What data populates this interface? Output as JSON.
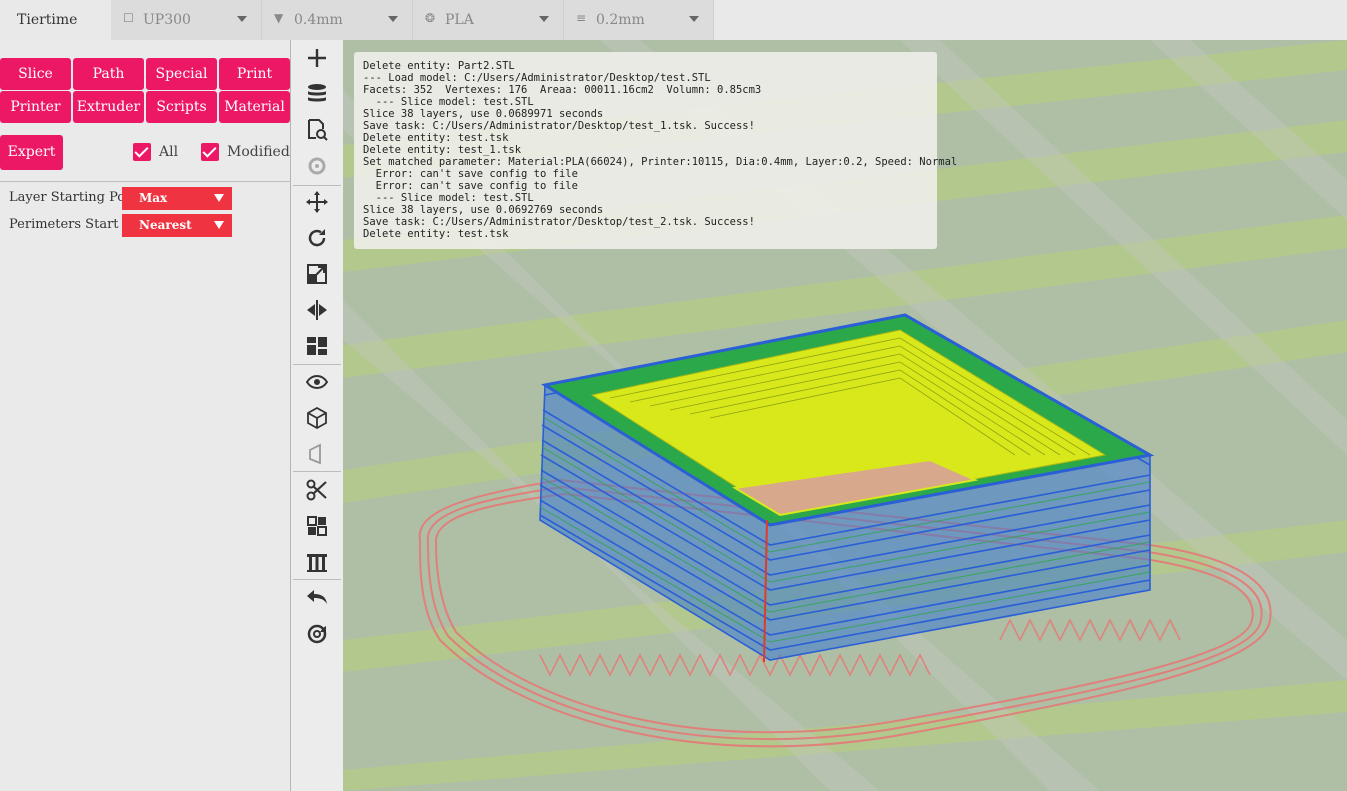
{
  "app": {
    "title": "Tiertime"
  },
  "top_combos": [
    {
      "icon": "printer-icon",
      "glyph": "☐",
      "value": "UP300"
    },
    {
      "icon": "nozzle-icon",
      "glyph": "▼",
      "value": "0.4mm"
    },
    {
      "icon": "material-icon",
      "glyph": "❂",
      "value": "PLA"
    },
    {
      "icon": "layer-icon",
      "glyph": "≡",
      "value": "0.2mm"
    }
  ],
  "tabs_row1": [
    "Slice",
    "Path",
    "Special",
    "Print"
  ],
  "tabs_row2": [
    "Printer",
    "Extruder",
    "Scripts",
    "Material"
  ],
  "expert_label": "Expert",
  "filters": {
    "all_label": "All",
    "all_checked": true,
    "modified_label": "Modified",
    "modified_checked": true
  },
  "params": [
    {
      "label": "Layer Starting Point",
      "value": "Max"
    },
    {
      "label": "Perimeters Start",
      "value": "Nearest"
    }
  ],
  "toolbar": [
    "add-icon",
    "database-icon",
    "search-file-icon",
    "camera-icon",
    "move-icon",
    "rotate-icon",
    "scale-icon",
    "mirror-icon",
    "layout-icon",
    "eye-icon",
    "cube-icon",
    "view-icon",
    "cut-icon",
    "grid-icon",
    "support-icon",
    "undo-icon",
    "settings-cycle-icon"
  ],
  "log": [
    "Delete entity: Part2.STL",
    "--- Load model: C:/Users/Administrator/Desktop/test.STL",
    "Facets: 352  Vertexes: 176  Areaa: 00011.16cm2  Volumn: 0.85cm3",
    "  --- Slice model: test.STL",
    "Slice 38 layers, use 0.0689971 seconds",
    "Save task: C:/Users/Administrator/Desktop/test_1.tsk. Success!",
    "Delete entity: test.tsk",
    "Delete entity: test_1.tsk",
    "Set matched parameter: Material:PLA(66024), Printer:10115, Dia:0.4mm, Layer:0.2, Speed: Normal",
    "  Error: can't save config to file",
    "  Error: can't save config to file",
    "  --- Slice model: test.STL",
    "Slice 38 layers, use 0.0692769 seconds",
    "Save task: C:/Users/Administrator/Desktop/test_2.tsk. Success!",
    "Delete entity: test.tsk"
  ],
  "colors": {
    "accent": "#ec1865",
    "select": "#ef3340",
    "perimeter": "#2a5fd6",
    "infill": "#d8e81a",
    "raft": "#e0807a"
  }
}
